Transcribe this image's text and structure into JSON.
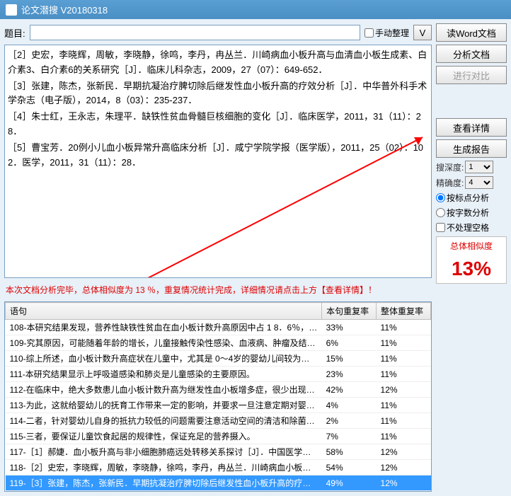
{
  "window": {
    "title": "论文潜搜 V20180318"
  },
  "topic": {
    "label": "题目:",
    "value": "",
    "manual_label": "手动整理",
    "v_btn": "V"
  },
  "buttons": {
    "read_word": "读Word文档",
    "analyze": "分析文档",
    "compare": "进行对比",
    "details": "查看详情",
    "report": "生成报告"
  },
  "refs": [
    "［2］史宏，李晓辉，周敏，李晓静，徐鸣，李丹，冉丛兰．川崎病血小板升高与血清血小板生成素、白介素3、白介素6的关系研究［J］．临床儿科杂志，2009，27（07）：649-652．",
    "［3］张建，陈杰，张新民．早期抗凝治疗脾切除后继发性血小板升高的疗效分析［J］．中华普外科手术学杂志（电子版），2014，8（03）：235-237．",
    "［4］朱士红，王永志，朱理平．缺铁性贫血骨髓巨核细胞的变化［J］．临床医学，2011，31（11）：28．",
    "［5］曹宝芳．20例小儿血小板异常升高临床分析［J］．咸宁学院学报（医学版），2011，25（02）：102．医学，2011，31（11）：28．"
  ],
  "options": {
    "depth_label": "搜深度:",
    "depth_value": "1",
    "accuracy_label": "精确度:",
    "accuracy_value": "4",
    "by_punct": "按标点分析",
    "by_chars": "按字数分析",
    "skip_space": "不处理空格"
  },
  "score": {
    "label": "总体相似度",
    "value": "13%"
  },
  "status": "本次文档分析完毕，总体相似度为 13 ％，重复情况统计完成，详细情况请点击上方【查看详情】！",
  "results": {
    "headers": {
      "sentence": "语句",
      "sent_rate": "本句重复率",
      "total_rate": "整体重复率"
    },
    "rows": [
      {
        "s": "108-本研究结果发现，营养性缺铁性贫血在血小板计数升高原因中占 1 8．6％，另外，...",
        "r1": "33%",
        "r2": "11%"
      },
      {
        "s": "109-究其原因，可能随着年龄的增长，儿童接触传染性感染、血液病、肿瘤及结缔组织疾...",
        "r1": "6%",
        "r2": "11%"
      },
      {
        "s": "110-综上所述，血小板计数升高症状在儿童中，尤其是 0～4岁的婴幼儿间较为常见，绝...",
        "r1": "15%",
        "r2": "11%"
      },
      {
        "s": "111-本研究结果显示上呼吸道感染和肺炎是儿童感染的主要原因。",
        "r1": "23%",
        "r2": "11%"
      },
      {
        "s": "112-在临床中，绝大多数患儿血小板计数升高为继发性血小板增多症，很少出现症状，即...",
        "r1": "42%",
        "r2": "12%"
      },
      {
        "s": "113-为此，这就给婴幼儿的抚育工作带来一定的影响，并要求一旦注意定期对婴幼儿进行常...",
        "r1": "4%",
        "r2": "11%"
      },
      {
        "s": "114-二者，针对婴幼儿自身的抵抗力较低的问题需要注意活动空间的清洁和除菌，防止感...",
        "r1": "2%",
        "r2": "11%"
      },
      {
        "s": "115-三者，要保证儿童饮食起居的规律性，保证充足的营养摄入。",
        "r1": "7%",
        "r2": "11%"
      },
      {
        "s": "117-［1］郝婕．血小板升高与非小细胞肺癌远处转移关系探讨［J］．中国医学创新，...",
        "r1": "58%",
        "r2": "12%"
      },
      {
        "s": "118-［2］史宏，李晓辉，周敏，李晓静，徐鸣，李丹，冉丛兰．川崎病血小板升高与血...",
        "r1": "54%",
        "r2": "12%"
      },
      {
        "s": "119-［3］张建，陈杰，张新民．早期抗凝治疗脾切除后继发性血小板升高的疗效分析［...",
        "r1": "49%",
        "r2": "12%",
        "sel": true
      }
    ]
  }
}
